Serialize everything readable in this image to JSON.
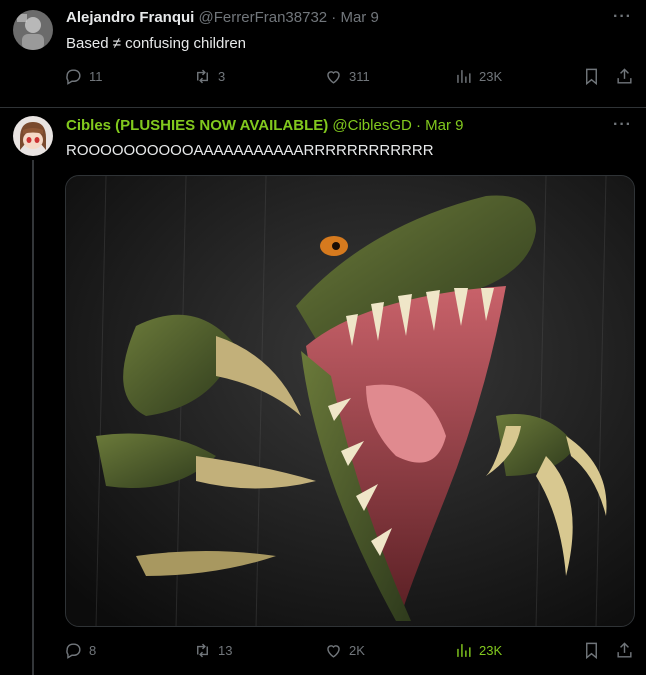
{
  "tweets": [
    {
      "display_name": "Alejandro Franqui",
      "handle_date": "@FerrerFran38732 · Mar 9",
      "text": "Based ≠ confusing children",
      "replies": "11",
      "reposts": "3",
      "likes": "311",
      "views": "23K"
    },
    {
      "display_name": "Cibles (PLUSHIES NOW AVAILABLE)",
      "handle_date": "@CiblesGD · Mar 9",
      "text": "ROOOOOOOOOOAAAAAAAAAAARRRRRRRRRRRR",
      "replies": "8",
      "reposts": "13",
      "likes": "2K",
      "views": "23K"
    }
  ],
  "icons": {
    "reply": "reply-icon",
    "repost": "repost-icon",
    "like": "heart-icon",
    "views": "views-icon",
    "bookmark": "bookmark-icon",
    "share": "share-icon",
    "more": "more-icon"
  },
  "colors": {
    "background": "#000000",
    "text": "#e7e9ea",
    "muted": "#71767b",
    "accent_green": "#82c91e",
    "divider": "#2f3336"
  }
}
